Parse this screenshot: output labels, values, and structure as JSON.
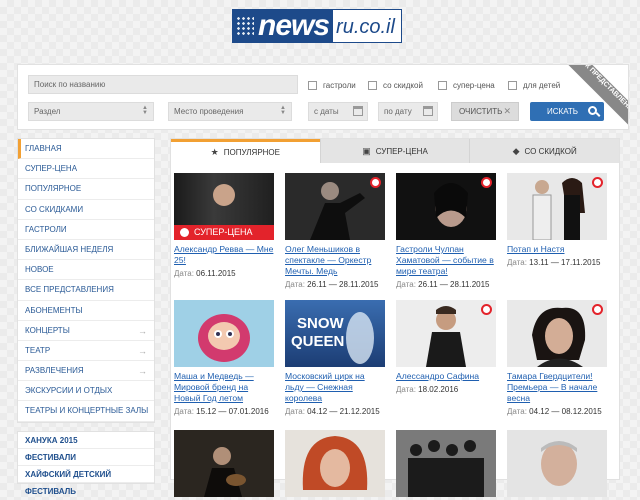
{
  "logo": {
    "brand": "news",
    "suffix": "ru.co.il"
  },
  "filter": {
    "search_placeholder": "Поиск по названию",
    "checkboxes": [
      "гастроли",
      "со скидкой",
      "супер-цена",
      "для детей"
    ],
    "section_label": "Раздел",
    "venue_label": "Место проведения",
    "date_from": "с даты",
    "date_to": "по дату",
    "clear_label": "ОЧИСТИТЬ",
    "search_label": "ИСКАТЬ",
    "ribbon": "ПОИСК ПРЕДСТАВЛЕНИЯ:"
  },
  "sidebar": {
    "items": [
      {
        "label": "Главная"
      },
      {
        "label": "Супер-цена"
      },
      {
        "label": "Популярное"
      },
      {
        "label": "Со скидками"
      },
      {
        "label": "Гастроли"
      },
      {
        "label": "Ближайшая неделя"
      },
      {
        "label": "Новое"
      },
      {
        "label": "Все представления"
      },
      {
        "label": "Абонементы"
      },
      {
        "label": "Концерты",
        "arrow": "→"
      },
      {
        "label": "Театр",
        "arrow": "→"
      },
      {
        "label": "Развлечения",
        "arrow": "→"
      },
      {
        "label": "Экскурсии и отдых"
      },
      {
        "label": "Театры и концертные залы"
      }
    ],
    "extra": [
      "ХАНУКА 2015",
      "ФЕСТИВАЛИ",
      "ХАЙФСКИЙ ДЕТСКИЙ ФЕСТИВАЛЬ"
    ]
  },
  "tabs": [
    {
      "label": "ПОПУЛЯРНОЕ",
      "icon": "★"
    },
    {
      "label": "СУПЕР-ЦЕНА",
      "icon": "🎁"
    },
    {
      "label": "СО СКИДКОЙ",
      "icon": "🏷"
    }
  ],
  "date_label": "Дата:",
  "super_badge": "СУПЕР-ЦЕНА",
  "cards": [
    {
      "title": "Александр Ревва — Мне 25!",
      "date": "06.11.2015"
    },
    {
      "title": "Олег Меньшиков в спектакле — Оркестр Мечты. Медь",
      "date": "26.11 — 28.11.2015"
    },
    {
      "title": "Гастроли Чулпан Хаматовой — событие в мире театра!",
      "date": "26.11 — 28.11.2015"
    },
    {
      "title": "Потап и Настя",
      "date": "13.11 — 17.11.2015"
    },
    {
      "title": "Маша и Медведь — Мировой бренд на Новый Год летом",
      "date": "15.12 — 07.01.2016"
    },
    {
      "title": "Московский цирк на льду — Снежная королева",
      "date": "04.12 — 21.12.2015"
    },
    {
      "title": "Алессандро Сафина",
      "date": "18.02.2016"
    },
    {
      "title": "Тамара Гвердцители! Премьера — В начале весна",
      "date": "04.12 — 08.12.2015"
    }
  ],
  "snow_queen": "SNOW QUEEN"
}
